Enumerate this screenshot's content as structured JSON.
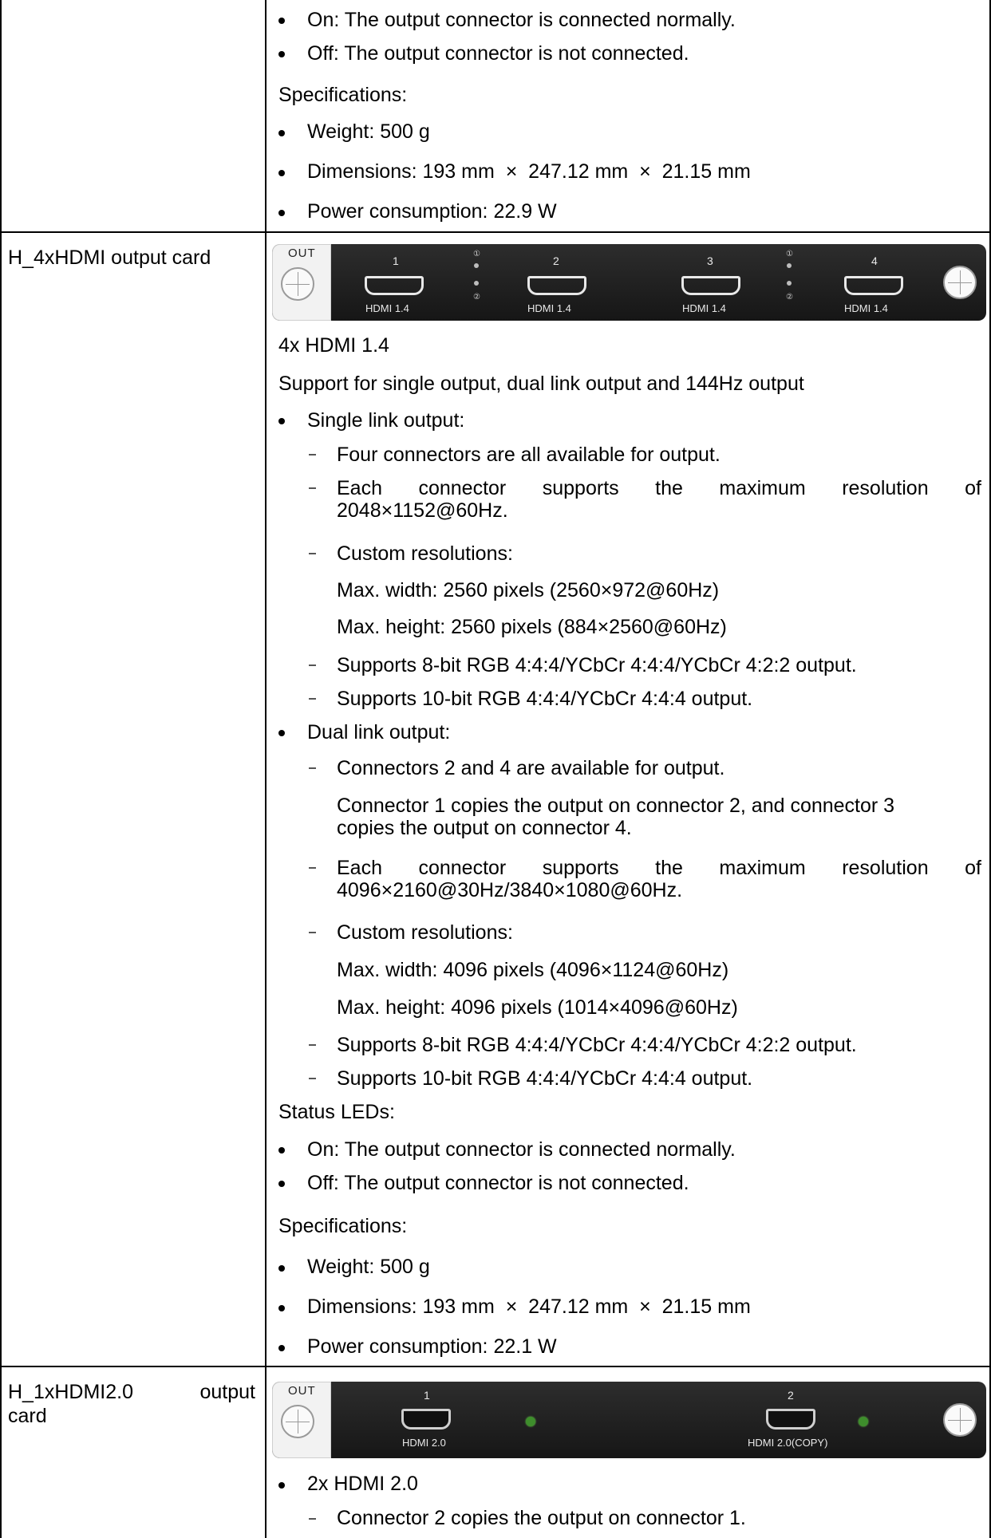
{
  "top_section": {
    "items": [
      "On: The output connector is connected normally.",
      "Off: The output connector is not connected."
    ],
    "specs_heading": "Specifications:",
    "specs": [
      "Weight: 500 g",
      "Dimensions: 193 mm  ×  247.12 mm  ×  21.15 mm",
      "Power consumption: 22.9 W"
    ]
  },
  "card1": {
    "name": "H_4xHDMI output card",
    "panel": {
      "out_label": "OUT",
      "port_numbers": [
        "1",
        "2",
        "3",
        "4"
      ],
      "port_labels": [
        "HDMI 1.4",
        "HDMI 1.4",
        "HDMI 1.4",
        "HDMI 1.4"
      ],
      "led_marks": [
        "①",
        "②"
      ]
    },
    "line1": "4x HDMI 1.4",
    "line2": "Support for single output, dual link output and 144Hz output",
    "single": {
      "heading": "Single link output:",
      "item1": "Four connectors are all available for output.",
      "item2_words": [
        "Each",
        "connector",
        "supports",
        "the",
        "maximum",
        "resolution",
        "of"
      ],
      "item2_cont": "2048×1152@60Hz.",
      "item3": "Custom resolutions:",
      "maxw": "Max. width: 2560 pixels (2560×972@60Hz)",
      "maxh": "Max. height: 2560 pixels (884×2560@60Hz)",
      "item4": "Supports 8-bit RGB 4:4:4/YCbCr 4:4:4/YCbCr 4:2:2 output.",
      "item5": "Supports 10-bit RGB 4:4:4/YCbCr 4:4:4 output."
    },
    "dual": {
      "heading": "Dual link output:",
      "item1": "Connectors 2 and 4 are available for output.",
      "note_line1": "Connector 1 copies the output on connector 2, and connector 3",
      "note_line2": "copies the output on connector 4.",
      "item2_words": [
        "Each",
        "connector",
        "supports",
        "the",
        "maximum",
        "resolution",
        "of"
      ],
      "item2_cont": "4096×2160@30Hz/3840×1080@60Hz.",
      "item3": "Custom resolutions:",
      "maxw": "Max. width: 4096 pixels (4096×1124@60Hz)",
      "maxh": "Max. height: 4096 pixels (1014×4096@60Hz)",
      "item4": "Supports 8-bit RGB 4:4:4/YCbCr 4:4:4/YCbCr 4:2:2 output.",
      "item5": "Supports 10-bit RGB 4:4:4/YCbCr 4:4:4 output."
    },
    "status_heading": "Status LEDs:",
    "status": [
      "On: The output connector is connected normally.",
      "Off: The output connector is not connected."
    ],
    "specs_heading": "Specifications:",
    "specs": [
      "Weight: 500 g",
      "Dimensions: 193 mm  ×  247.12 mm  ×  21.15 mm",
      "Power consumption: 22.1 W"
    ]
  },
  "card2": {
    "name_part1": "H_1xHDMI2.0",
    "name_part2": "output",
    "name_part3": "card",
    "panel": {
      "out_label": "OUT",
      "port_numbers": [
        "1",
        "2"
      ],
      "port_labels": [
        "HDMI 2.0",
        "HDMI 2.0(COPY)"
      ]
    },
    "item1": "2x HDMI 2.0",
    "sub1": "Connector 2 copies the output on connector 1."
  }
}
